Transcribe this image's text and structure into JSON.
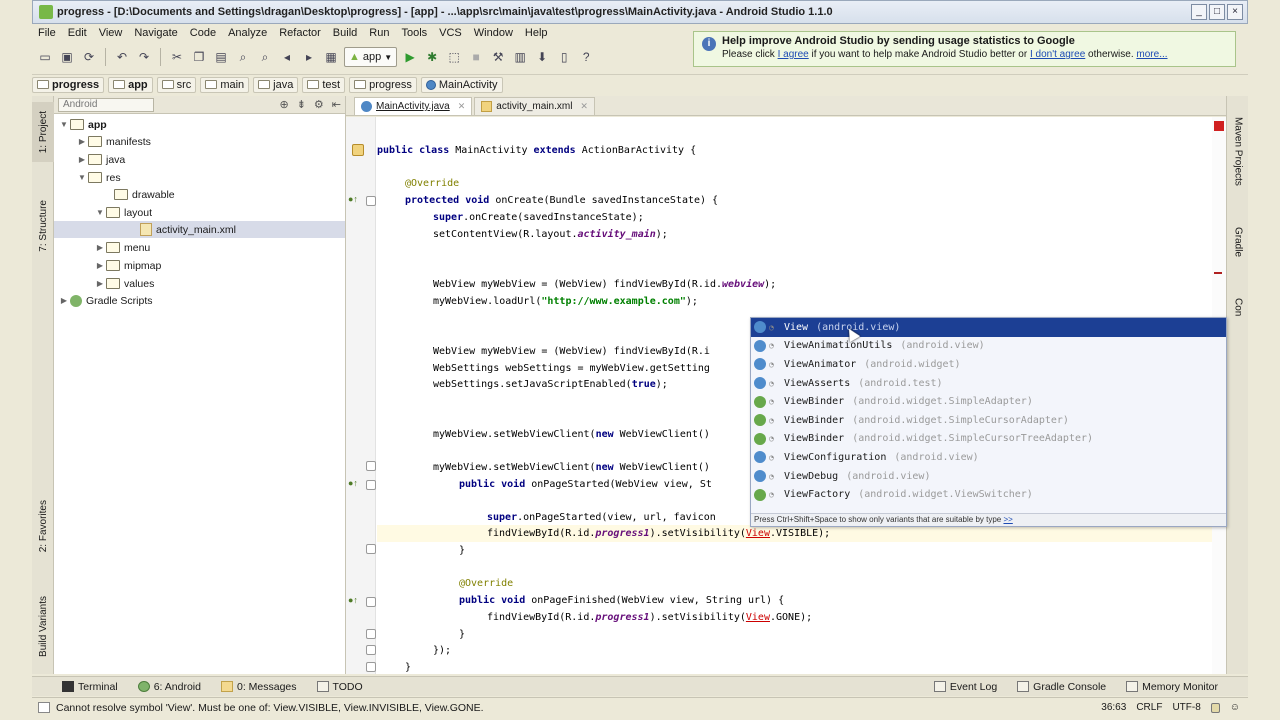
{
  "window": {
    "title": "progress - [D:\\Documents and Settings\\dragan\\Desktop\\progress] - [app] - ...\\app\\src\\main\\java\\test\\progress\\MainActivity.java - Android Studio 1.1.0",
    "btn_min": "_",
    "btn_max": "□",
    "btn_close": "×"
  },
  "menu": [
    "File",
    "Edit",
    "View",
    "Navigate",
    "Code",
    "Analyze",
    "Refactor",
    "Build",
    "Run",
    "Tools",
    "VCS",
    "Window",
    "Help"
  ],
  "toolbar": {
    "run_config": "app"
  },
  "notification": {
    "title": "Help improve Android Studio by sending usage statistics to Google",
    "body_prefix": "Please click ",
    "agree": "I agree",
    "body_mid": " if you want to help make Android Studio better or ",
    "disagree": "I don't agree",
    "body_suffix": " otherwise. ",
    "more": "more..."
  },
  "breadcrumb": [
    "progress",
    "app",
    "src",
    "main",
    "java",
    "test",
    "progress",
    "MainActivity"
  ],
  "left_strip": {
    "project": "1: Project",
    "structure": "7: Structure",
    "favorites": "2: Favorites",
    "build_variants": "Build Variants"
  },
  "right_strip": {
    "maven": "Maven Projects",
    "gradle": "Gradle",
    "commander": "Con"
  },
  "project_panel": {
    "view": "Android",
    "tree": [
      {
        "label": "app",
        "bold": true
      },
      {
        "label": "manifests"
      },
      {
        "label": "java"
      },
      {
        "label": "res"
      },
      {
        "label": "drawable"
      },
      {
        "label": "layout"
      },
      {
        "label": "activity_main.xml"
      },
      {
        "label": "menu"
      },
      {
        "label": "mipmap"
      },
      {
        "label": "values"
      },
      {
        "label": "Gradle Scripts"
      }
    ]
  },
  "editor_tabs": [
    {
      "label": "MainActivity.java"
    },
    {
      "label": "activity_main.xml"
    }
  ],
  "code": {
    "l1_kw": "public class",
    "l1_rest": " MainActivity ",
    "l1_kw2": "extends",
    "l1_tail": " ActionBarActivity {",
    "l2": "@Override",
    "l3_kw": "protected void",
    "l3_rest": " onCreate(Bundle savedInstanceState) {",
    "l4_kw": "super",
    "l4_rest": ".onCreate(savedInstanceState);",
    "l5_a": "setContentView(R.layout.",
    "l5_f": "activity_main",
    "l5_b": ");",
    "l6_a": "WebView myWebView = (WebView) findViewById(R.id.",
    "l6_f": "webview",
    "l6_b": ");",
    "l7_a": "myWebView.loadUrl(",
    "l7_s": "\"http://www.example.com\"",
    "l7_b": ");",
    "l8": "WebView myWebView = (WebView) findViewById(R.i",
    "l9": "WebSettings webSettings = myWebView.getSetting",
    "l10_a": "webSettings.setJavaScriptEnabled(",
    "l10_kw": "true",
    "l10_b": ");",
    "l11_a": "myWebView.setWebViewClient(",
    "l11_kw": "new",
    "l11_b": " WebViewClient()",
    "l12_a": "myWebView.setWebViewClient(",
    "l12_kw": "new",
    "l12_b": " WebViewClient()",
    "l13_kw": "public void",
    "l13_rest": " onPageStarted(WebView view, St",
    "l14_kw": "super",
    "l14_rest": ".onPageStarted(view, url, favicon",
    "l15_a": "findViewById(R.id.",
    "l15_f": "progress1",
    "l15_b": ").setVisibility(",
    "l15_e": "View",
    "l15_c": ".VISIBLE);",
    "l16": "}",
    "l17": "@Override",
    "l18_kw": "public void",
    "l18_rest": " onPageFinished(WebView view, String url) {",
    "l19_a": "findViewById(R.id.",
    "l19_f": "progress1",
    "l19_b": ").setVisibility(",
    "l19_e": "View",
    "l19_c": ".GONE);",
    "l20": "}",
    "l21": "});",
    "l22": "}"
  },
  "completion": {
    "items": [
      {
        "name": "View",
        "pkg": "(android.view)",
        "kind": "class",
        "selected": true
      },
      {
        "name": "ViewAnimationUtils",
        "pkg": "(android.view)",
        "kind": "class"
      },
      {
        "name": "ViewAnimator",
        "pkg": "(android.widget)",
        "kind": "class"
      },
      {
        "name": "ViewAsserts",
        "pkg": "(android.test)",
        "kind": "class"
      },
      {
        "name": "ViewBinder",
        "pkg": "(android.widget.SimpleAdapter)",
        "kind": "interface"
      },
      {
        "name": "ViewBinder",
        "pkg": "(android.widget.SimpleCursorAdapter)",
        "kind": "interface"
      },
      {
        "name": "ViewBinder",
        "pkg": "(android.widget.SimpleCursorTreeAdapter)",
        "kind": "interface"
      },
      {
        "name": "ViewConfiguration",
        "pkg": "(android.view)",
        "kind": "class"
      },
      {
        "name": "ViewDebug",
        "pkg": "(android.view)",
        "kind": "class"
      },
      {
        "name": "ViewFactory",
        "pkg": "(android.widget.ViewSwitcher)",
        "kind": "interface"
      }
    ],
    "hint": "Press Ctrl+Shift+Space to show only variants that are suitable by type ",
    "hint_link": ">>"
  },
  "tool_windows": {
    "terminal": "Terminal",
    "android": "6: Android",
    "messages": "0: Messages",
    "todo": "TODO",
    "event_log": "Event Log",
    "gradle_console": "Gradle Console",
    "memory_monitor": "Memory Monitor"
  },
  "status": {
    "message": "Cannot resolve symbol 'View'. Must be one of: View.VISIBLE, View.INVISIBLE, View.GONE.",
    "position": "36:63",
    "line_sep": "CRLF",
    "encoding": "UTF-8"
  }
}
